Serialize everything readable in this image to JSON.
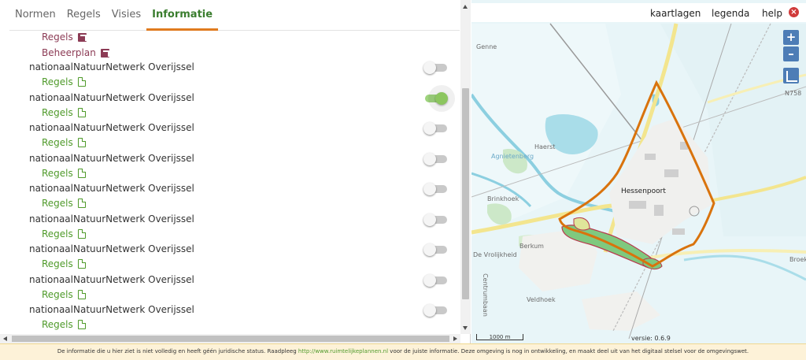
{
  "tabs": [
    {
      "label": "Normen",
      "active": false
    },
    {
      "label": "Regels",
      "active": false
    },
    {
      "label": "Visies",
      "active": false
    },
    {
      "label": "Informatie",
      "active": true
    }
  ],
  "links_top": [
    {
      "label": "Regels",
      "icon": "external-link-icon"
    },
    {
      "label": "Beheerplan",
      "icon": "external-link-icon"
    }
  ],
  "items": [
    {
      "title": "nationaalNatuurNetwerk Overijssel",
      "doc_label": "Regels",
      "toggle": false
    },
    {
      "title": "nationaalNatuurNetwerk Overijssel",
      "doc_label": "Regels",
      "toggle": true
    },
    {
      "title": "nationaalNatuurNetwerk Overijssel",
      "doc_label": "Regels",
      "toggle": false
    },
    {
      "title": "nationaalNatuurNetwerk Overijssel",
      "doc_label": "Regels",
      "toggle": false
    },
    {
      "title": "nationaalNatuurNetwerk Overijssel",
      "doc_label": "Regels",
      "toggle": false
    },
    {
      "title": "nationaalNatuurNetwerk Overijssel",
      "doc_label": "Regels",
      "toggle": false
    },
    {
      "title": "nationaalNatuurNetwerk Overijssel",
      "doc_label": "Regels",
      "toggle": false
    },
    {
      "title": "nationaalNatuurNetwerk Overijssel",
      "doc_label": "Regels",
      "toggle": false
    },
    {
      "title": "nationaalNatuurNetwerk Overijssel",
      "doc_label": "Regels",
      "toggle": false
    }
  ],
  "map": {
    "menu": {
      "layers": "kaartlagen",
      "legend": "legenda",
      "help": "help"
    },
    "zoom_in": "+",
    "zoom_out": "–",
    "labels": {
      "genne": "Genne",
      "n758": "N758",
      "haerst": "Haerst",
      "agnietenberg": "Agnietenberg",
      "hessenpoort": "Hessenpoort",
      "brinkhoek": "Brinkhoek",
      "berkum": "Berkum",
      "vrolijkheid": "De Vrolijkheid",
      "centrumbaan": "Centrumbaan",
      "veldhoek": "Veldhoek",
      "broekh": "Broekh"
    },
    "scale": "1000 m",
    "version": "versie: 0.6.9",
    "colors": {
      "water": "#a9dde9",
      "area_outline": "#d9730d",
      "nature": "#7fc97f",
      "road": "#f3e58e"
    }
  },
  "footer": {
    "text_before": "De informatie die u hier ziet is niet volledig en heeft géén juridische status. Raadpleeg ",
    "link": "http://www.ruimtelijkeplannen.nl",
    "text_after": " voor de juiste informatie. Deze omgeving is nog in ontwikkeling, en maakt deel uit van het digitaal stelsel voor de omgevingswet."
  }
}
